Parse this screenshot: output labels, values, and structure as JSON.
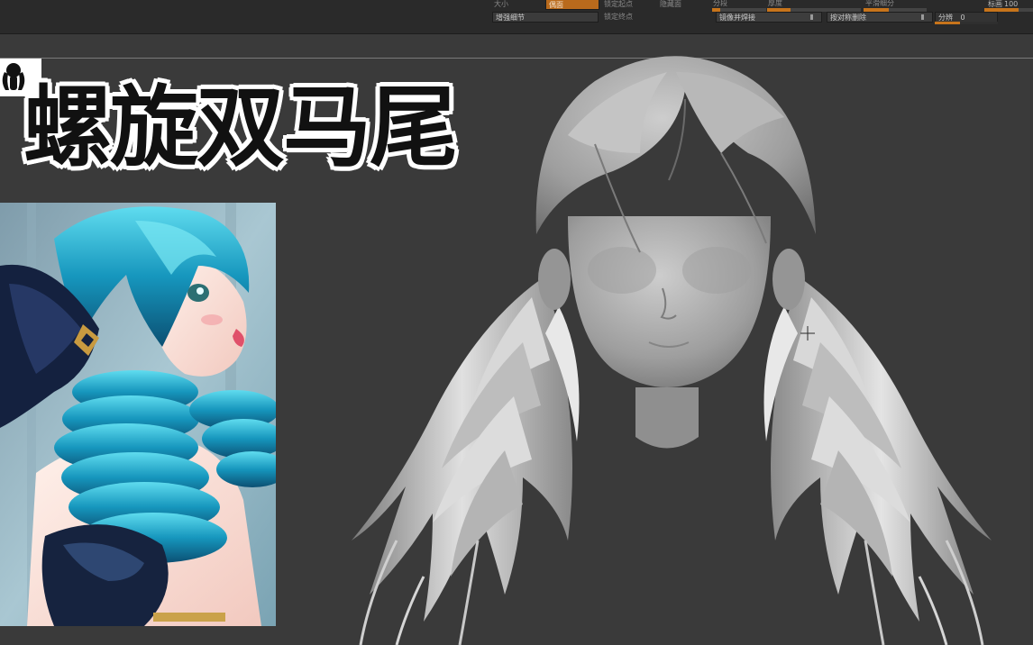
{
  "toolbar": {
    "size_label": "大小",
    "dynamic_button": "偶面",
    "lock_start": "锁定起点",
    "hide_front": "隐藏面",
    "enhance_detail": "增强细节",
    "lock_end": "锁定终点",
    "segment_label": "分段",
    "thickness_label": "厚度",
    "smooth_subdiv_label": "平滑细分",
    "mirror_weld": "镜像并焊接",
    "symmetry_delete": "按对称删除",
    "split_label": "分辨",
    "split_value": "0",
    "scale_label": "标画",
    "scale_value": "100",
    "thickness_fill": 0.25,
    "segment_fill": 0.15,
    "split_fill": 0.4
  },
  "title": {
    "text": "螺旋双马尾"
  },
  "colors": {
    "accent": "#c7741b",
    "viewport_bg": "#3a3a3a",
    "sculpt": "#a9a9a9",
    "hair_reference": "#1aa0c8"
  },
  "icons": {
    "logo": "twin-tail-girl-silhouette-icon",
    "cursor": "crosshair-icon"
  }
}
